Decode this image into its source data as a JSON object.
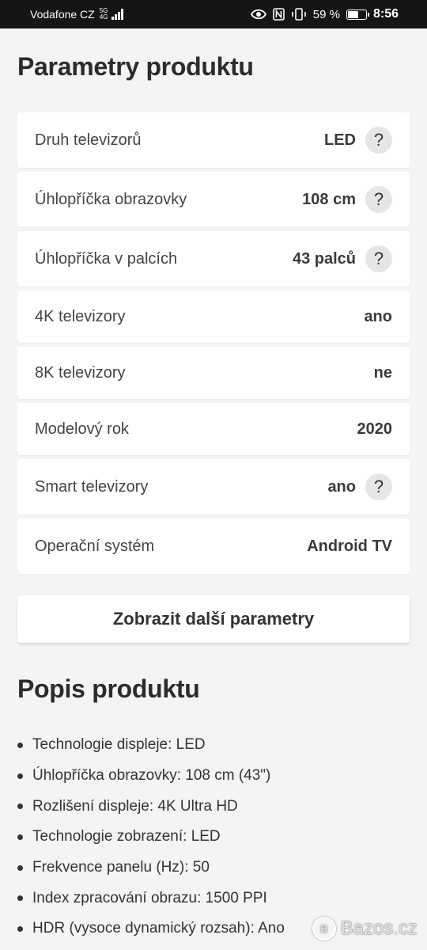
{
  "status_bar": {
    "carrier": "Vodafone CZ",
    "network_top": "5G",
    "network_bottom": "4G",
    "battery": "59 %",
    "time": "8:56"
  },
  "parameters": {
    "title": "Parametry produktu",
    "rows": [
      {
        "label": "Druh televizorů",
        "value": "LED",
        "help": "?"
      },
      {
        "label": "Úhlopříčka obrazovky",
        "value": "108 cm",
        "help": "?"
      },
      {
        "label": "Úhlopříčka v palcích",
        "value": "43 palců",
        "help": "?"
      },
      {
        "label": "4K televizory",
        "value": "ano"
      },
      {
        "label": "8K televizory",
        "value": "ne"
      },
      {
        "label": "Modelový rok",
        "value": "2020"
      },
      {
        "label": "Smart televizory",
        "value": "ano",
        "help": "?"
      },
      {
        "label": "Operační systém",
        "value": "Android TV"
      }
    ],
    "more_button": "Zobrazit další parametry"
  },
  "description": {
    "title": "Popis produktu",
    "items": [
      "Technologie displeje: LED",
      "Úhlopříčka obrazovky: 108 cm (43\")",
      "Rozlišení displeje: 4K Ultra HD",
      "Technologie zobrazení: LED",
      "Frekvence panelu (Hz): 50",
      "Index zpracování obrazu: 1500 PPI",
      "HDR (vysoce dynamický rozsah): Ano"
    ]
  },
  "watermark": {
    "logo_letter": "B",
    "text": "Bazos.cz"
  }
}
